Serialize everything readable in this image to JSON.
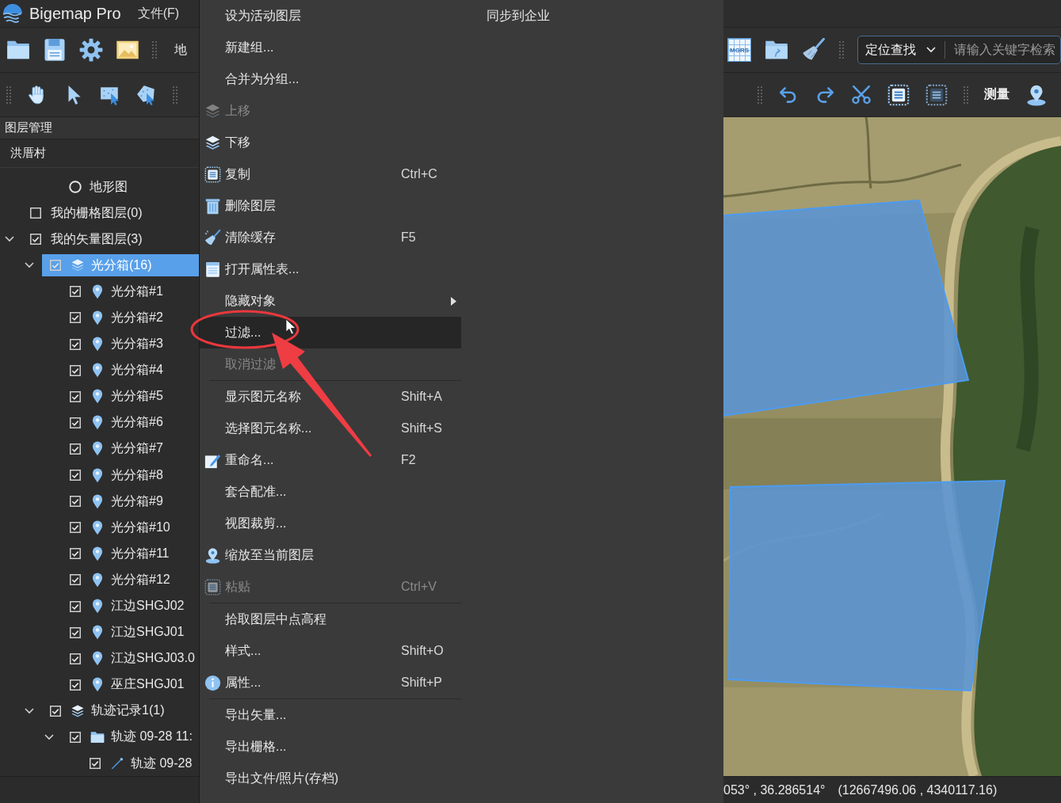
{
  "title_bar": {
    "app_name": "Bigemap Pro",
    "menus": [
      "文件(F)"
    ]
  },
  "toolbar": {
    "map_dropdown": "地",
    "grid_button": "MGRS",
    "search": {
      "mode": "定位查找",
      "placeholder": "请输入关键字检索"
    },
    "measure": "测量"
  },
  "layer_panel": {
    "title": "图层管理",
    "project": "洪厝村",
    "tree": [
      {
        "kind": "radio",
        "label": "地形图",
        "checked": false,
        "selected": false
      },
      {
        "kind": "layer",
        "label": "我的栅格图层(0)",
        "checked": false,
        "selected": false
      },
      {
        "kind": "layer",
        "label": "我的矢量图层(3)",
        "checked": true,
        "selected": false,
        "expanded": true,
        "children": [
          {
            "kind": "group",
            "label": "光分箱(16)",
            "checked": true,
            "selected": true,
            "expanded": true,
            "children": [
              {
                "kind": "point",
                "label": "光分箱#1",
                "checked": true,
                "selected": false
              },
              {
                "kind": "point",
                "label": "光分箱#2",
                "checked": true,
                "selected": false
              },
              {
                "kind": "point",
                "label": "光分箱#3",
                "checked": true,
                "selected": false
              },
              {
                "kind": "point",
                "label": "光分箱#4",
                "checked": true,
                "selected": false
              },
              {
                "kind": "point",
                "label": "光分箱#5",
                "checked": true,
                "selected": false
              },
              {
                "kind": "point",
                "label": "光分箱#6",
                "checked": true,
                "selected": false
              },
              {
                "kind": "point",
                "label": "光分箱#7",
                "checked": true,
                "selected": false
              },
              {
                "kind": "point",
                "label": "光分箱#8",
                "checked": true,
                "selected": false
              },
              {
                "kind": "point",
                "label": "光分箱#9",
                "checked": true,
                "selected": false
              },
              {
                "kind": "point",
                "label": "光分箱#10",
                "checked": true,
                "selected": false
              },
              {
                "kind": "point",
                "label": "光分箱#11",
                "checked": true,
                "selected": false
              },
              {
                "kind": "point",
                "label": "光分箱#12",
                "checked": true,
                "selected": false
              },
              {
                "kind": "point",
                "label": "江边SHGJ02",
                "checked": true,
                "selected": false
              },
              {
                "kind": "point",
                "label": "江边SHGJ01",
                "checked": true,
                "selected": false
              },
              {
                "kind": "point",
                "label": "江边SHGJ03.0",
                "checked": true,
                "selected": false
              },
              {
                "kind": "point",
                "label": "巫庄SHGJ01",
                "checked": true,
                "selected": false
              }
            ]
          },
          {
            "kind": "group",
            "label": "轨迹记录1(1)",
            "checked": true,
            "selected": false,
            "expanded": true,
            "children": [
              {
                "kind": "folder",
                "label": "轨迹 09-28 11:",
                "checked": true,
                "selected": false,
                "expanded": true,
                "children": [
                  {
                    "kind": "track",
                    "label": "轨迹 09-28",
                    "checked": true,
                    "selected": false
                  }
                ]
              }
            ]
          }
        ]
      }
    ]
  },
  "context_menu": {
    "items": [
      {
        "kind": "item",
        "label": "设为活动图层",
        "disabled": false,
        "selected": false
      },
      {
        "kind": "item",
        "label": "新建组...",
        "disabled": false,
        "selected": false
      },
      {
        "kind": "item",
        "label": "合并为分组...",
        "disabled": false,
        "selected": false
      },
      {
        "kind": "item",
        "label": "上移",
        "disabled": true,
        "selected": false
      },
      {
        "kind": "item",
        "label": "下移",
        "disabled": false,
        "selected": false
      },
      {
        "kind": "item",
        "label": "复制",
        "shortcut": "Ctrl+C",
        "disabled": false,
        "selected": false
      },
      {
        "kind": "item",
        "label": "删除图层",
        "disabled": false,
        "selected": false
      },
      {
        "kind": "item",
        "label": "清除缓存",
        "shortcut": "F5",
        "disabled": false,
        "selected": false
      },
      {
        "kind": "item",
        "label": "打开属性表...",
        "disabled": false,
        "selected": false
      },
      {
        "kind": "submenu",
        "label": "隐藏对象",
        "disabled": false,
        "selected": false
      },
      {
        "kind": "item",
        "label": "过滤...",
        "disabled": false,
        "selected": true
      },
      {
        "kind": "item",
        "label": "取消过滤",
        "disabled": true,
        "selected": false
      },
      {
        "kind": "separator"
      },
      {
        "kind": "item",
        "label": "显示图元名称",
        "shortcut": "Shift+A",
        "disabled": false,
        "selected": false
      },
      {
        "kind": "item",
        "label": "选择图元名称...",
        "shortcut": "Shift+S",
        "disabled": false,
        "selected": false
      },
      {
        "kind": "item",
        "label": "重命名...",
        "shortcut": "F2",
        "disabled": false,
        "selected": false
      },
      {
        "kind": "item",
        "label": "套合配准...",
        "disabled": false,
        "selected": false
      },
      {
        "kind": "item",
        "label": "视图裁剪...",
        "disabled": false,
        "selected": false
      },
      {
        "kind": "item",
        "label": "缩放至当前图层",
        "disabled": false,
        "selected": false
      },
      {
        "kind": "item",
        "label": "粘贴",
        "shortcut": "Ctrl+V",
        "disabled": true,
        "selected": false
      },
      {
        "kind": "separator"
      },
      {
        "kind": "item",
        "label": "拾取图层中点高程",
        "disabled": false,
        "selected": false
      },
      {
        "kind": "item",
        "label": "样式...",
        "shortcut": "Shift+O",
        "disabled": false,
        "selected": false
      },
      {
        "kind": "item",
        "label": "属性...",
        "shortcut": "Shift+P",
        "disabled": false,
        "selected": false
      },
      {
        "kind": "separator"
      },
      {
        "kind": "item",
        "label": "导出矢量...",
        "disabled": false,
        "selected": false
      },
      {
        "kind": "item",
        "label": "导出栅格...",
        "disabled": false,
        "selected": false
      },
      {
        "kind": "item",
        "label": "导出文件/照片(存档)",
        "disabled": false,
        "selected": false
      }
    ],
    "column_2": [
      {
        "label": "同步到企业",
        "disabled": false,
        "selected": false
      }
    ]
  },
  "annotations": [
    {
      "kind": "ellipse"
    },
    {
      "kind": "arrow"
    }
  ],
  "status_bar": {
    "geographic": "053° , 36.286514°",
    "projected": "(12667496.06 , 4340117.16)"
  }
}
